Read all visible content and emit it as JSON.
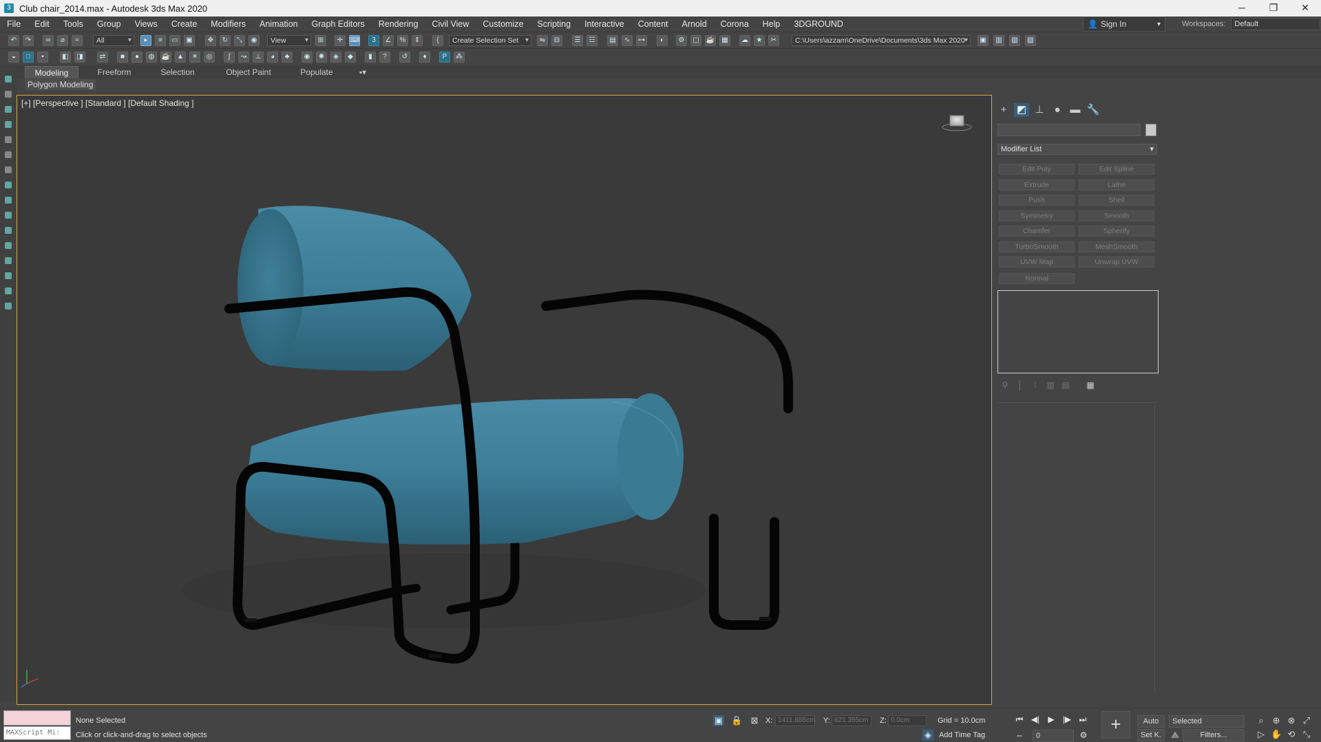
{
  "window": {
    "title": "Club chair_2014.max - Autodesk 3ds Max 2020",
    "minimize": "─",
    "restore": "❐",
    "close": "✕"
  },
  "menu": [
    "File",
    "Edit",
    "Tools",
    "Group",
    "Views",
    "Create",
    "Modifiers",
    "Animation",
    "Graph Editors",
    "Rendering",
    "Civil View",
    "Customize",
    "Scripting",
    "Interactive",
    "Content",
    "Arnold",
    "Corona",
    "Help",
    "3DGROUND"
  ],
  "signin": {
    "label": "Sign In"
  },
  "workspaces": {
    "label": "Workspaces:",
    "value": "Default"
  },
  "toolbar": {
    "selection_filter": "All",
    "ref_coord": "View",
    "named_selection": "Create Selection Set",
    "project_path": "C:\\Users\\azzam\\OneDrive\\Documents\\3ds Max 2020"
  },
  "ribbon": {
    "tabs": [
      "Modeling",
      "Freeform",
      "Selection",
      "Object Paint",
      "Populate"
    ],
    "active_tab": "Modeling",
    "sub_label": "Polygon Modeling"
  },
  "viewport": {
    "label": "[+] [Perspective ] [Standard ] [Default Shading ]",
    "cushion_color": "#3e7e98",
    "frame_color": "#050505",
    "border_color": "#d9a637"
  },
  "command_panel": {
    "modifier_list": "Modifier List",
    "modifiers": [
      "Edit Poly",
      "Edit Spline",
      "Extrude",
      "Lathe",
      "Push",
      "Shell",
      "Symmetry",
      "Smooth",
      "Chamfer",
      "Spherify",
      "TurboSmooth",
      "MeshSmooth",
      "UVW Map",
      "Unwrap UVW",
      "Normal"
    ]
  },
  "status": {
    "maxscript_placeholder": "MAXScript Mi:",
    "selection": "None Selected",
    "prompt": "Click or click-and-drag to select objects",
    "x_label": "X:",
    "x_value": "1411.886cm",
    "y_label": "Y:",
    "y_value": "621.355cm",
    "z_label": "Z:",
    "z_value": "0.0cm",
    "grid": "Grid = 10.0cm",
    "add_time_tag": "Add Time Tag",
    "auto_key": "Auto",
    "set_key": "Set K.",
    "key_filter_select": "Selected",
    "filters": "Filters...",
    "frame": "0"
  }
}
